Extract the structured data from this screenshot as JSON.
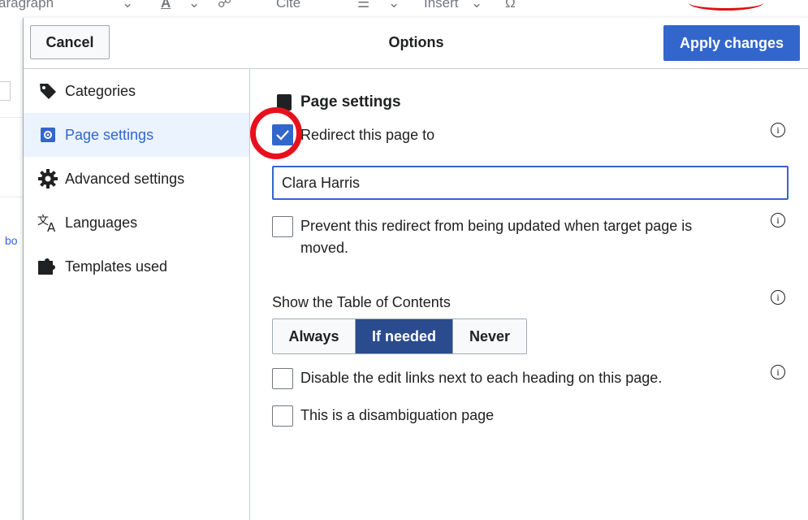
{
  "background_toolbar": {
    "items": [
      "aragraph",
      "⌄",
      "A",
      "⌄",
      "☍",
      "Cite",
      "☰",
      "⌄",
      "Insert",
      "⌄",
      "Ω"
    ],
    "side_text": "bo"
  },
  "dialog": {
    "title": "Options",
    "cancel_label": "Cancel",
    "apply_label": "Apply changes"
  },
  "sidebar": {
    "items": [
      {
        "label": "Categories",
        "icon": "tag-icon"
      },
      {
        "label": "Page settings",
        "icon": "page-settings-icon",
        "active": true
      },
      {
        "label": "Advanced settings",
        "icon": "gear-icon"
      },
      {
        "label": "Languages",
        "icon": "language-icon"
      },
      {
        "label": "Templates used",
        "icon": "puzzle-icon"
      }
    ]
  },
  "panel": {
    "title": "Page settings",
    "redirect": {
      "label": "Redirect this page to",
      "checked": true,
      "value": "Clara Harris"
    },
    "prevent_redirect_update": {
      "label_line1": "Prevent this redirect from being updated when target page is",
      "label_line2": "moved.",
      "checked": false
    },
    "toc": {
      "label": "Show the Table of Contents",
      "options": [
        "Always",
        "If needed",
        "Never"
      ],
      "selected": "If needed"
    },
    "disable_edit_links": {
      "label": "Disable the edit links next to each heading on this page.",
      "checked": false
    },
    "disambiguation": {
      "label": "This is a disambiguation page",
      "checked": false
    },
    "info_glyph": "i"
  },
  "colors": {
    "accent": "#3366cc",
    "selected_segment": "#2a4b8d",
    "annotation_red": "#e8101c",
    "active_bg": "#eaf3ff"
  }
}
